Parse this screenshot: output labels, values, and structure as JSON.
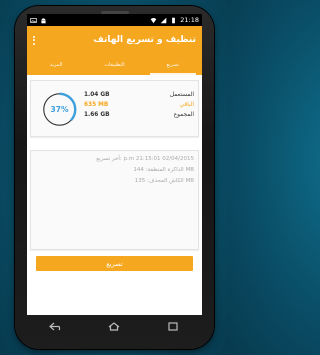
{
  "status_bar": {
    "time": "21:18",
    "icons": [
      "signal-icon",
      "wifi-icon",
      "battery-icon",
      "android-icon",
      "image-icon"
    ]
  },
  "app": {
    "title": "تنظيف و تسريع الهاتف",
    "tabs": [
      {
        "label": "المزيد"
      },
      {
        "label": "التطبيقات"
      },
      {
        "label": "تسريع",
        "active": true
      }
    ]
  },
  "memory": {
    "percent": "37%",
    "percent_value": 0.37,
    "used_label": "المستعمل",
    "used_value": "1.04 GB",
    "free_label": "الباقي",
    "free_value": "635 MB",
    "total_label": "المجموع",
    "total_value": "1.66 GB"
  },
  "info": {
    "last_boost": "أخر تسريع: p.m 21:15:01 02/04/2015",
    "freed_memory": "الذاكرة المنظفة: 144 MB",
    "killed_memory": "الكاش المحذف: 135 MB"
  },
  "boost_button": "تسريع",
  "colors": {
    "accent": "#f5a71f",
    "gauge": "#3d9fdc",
    "gauge_track": "#333333"
  }
}
